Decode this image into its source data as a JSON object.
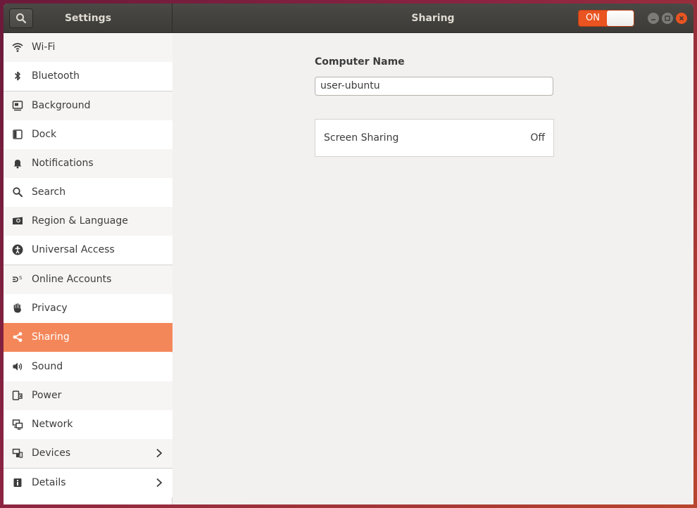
{
  "header": {
    "app_title": "Settings",
    "page_title": "Sharing",
    "switch_label": "ON",
    "accent_color": "#e95420"
  },
  "sidebar": {
    "items": [
      {
        "label": "Wi-Fi",
        "icon": "wifi-icon"
      },
      {
        "label": "Bluetooth",
        "icon": "bluetooth-icon"
      },
      {
        "label": "Background",
        "icon": "background-icon"
      },
      {
        "label": "Dock",
        "icon": "dock-icon"
      },
      {
        "label": "Notifications",
        "icon": "bell-icon"
      },
      {
        "label": "Search",
        "icon": "search-icon"
      },
      {
        "label": "Region & Language",
        "icon": "region-icon"
      },
      {
        "label": "Universal Access",
        "icon": "accessibility-icon"
      },
      {
        "label": "Online Accounts",
        "icon": "online-accounts-icon"
      },
      {
        "label": "Privacy",
        "icon": "hand-icon"
      },
      {
        "label": "Sharing",
        "icon": "share-icon",
        "selected": true
      },
      {
        "label": "Sound",
        "icon": "speaker-icon"
      },
      {
        "label": "Power",
        "icon": "power-icon"
      },
      {
        "label": "Network",
        "icon": "network-icon"
      },
      {
        "label": "Devices",
        "icon": "devices-icon"
      },
      {
        "label": "Details",
        "icon": "info-icon"
      }
    ],
    "selected_color": "#f4875a"
  },
  "main": {
    "computer_name_label": "Computer Name",
    "computer_name_value": "user-ubuntu",
    "screen_sharing_label": "Screen Sharing",
    "screen_sharing_value": "Off"
  }
}
